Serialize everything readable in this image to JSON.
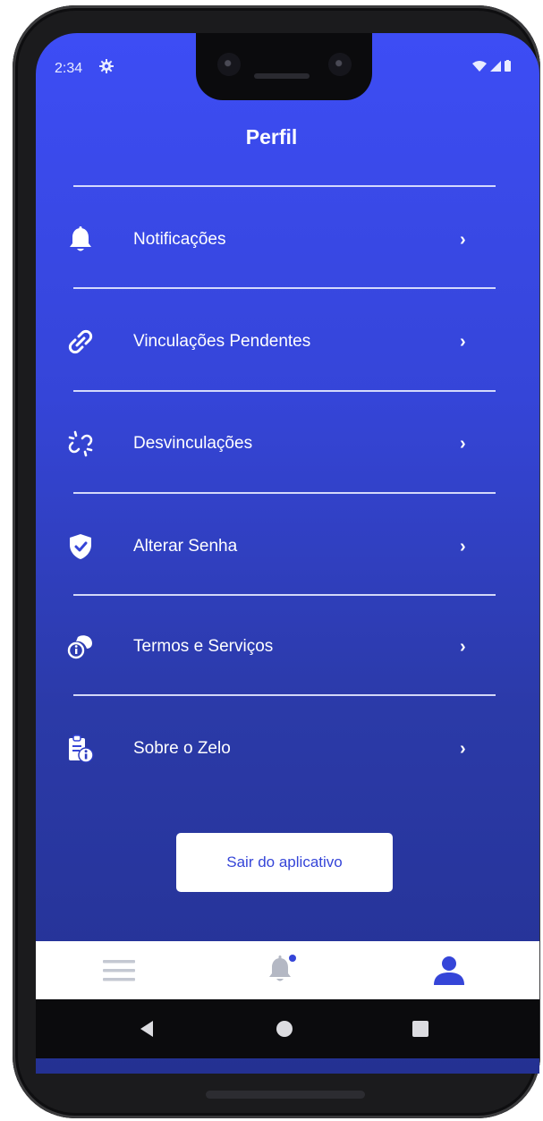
{
  "status": {
    "time": "2:34"
  },
  "header": {
    "title": "Perfil"
  },
  "menu": [
    {
      "label": "Notificações",
      "icon": "bell-icon"
    },
    {
      "label": "Vinculações Pendentes",
      "icon": "link-icon"
    },
    {
      "label": "Desvinculações",
      "icon": "broken-link-icon"
    },
    {
      "label": "Alterar Senha",
      "icon": "shield-check-icon"
    },
    {
      "label": "Termos e Serviços",
      "icon": "terms-icon"
    },
    {
      "label": "Sobre o Zelo",
      "icon": "clipboard-info-icon"
    }
  ],
  "chevron": "›",
  "logout": {
    "label": "Sair do aplicativo"
  },
  "bottom_nav": [
    {
      "name": "menu-icon",
      "active": false
    },
    {
      "name": "notifications-bell-icon",
      "active": false,
      "badge": true
    },
    {
      "name": "profile-icon",
      "active": true
    }
  ],
  "colors": {
    "primary": "#3545d8",
    "inactive": "#b4b8c4",
    "background_top": "#3d4df5",
    "background_bottom": "#243192"
  }
}
